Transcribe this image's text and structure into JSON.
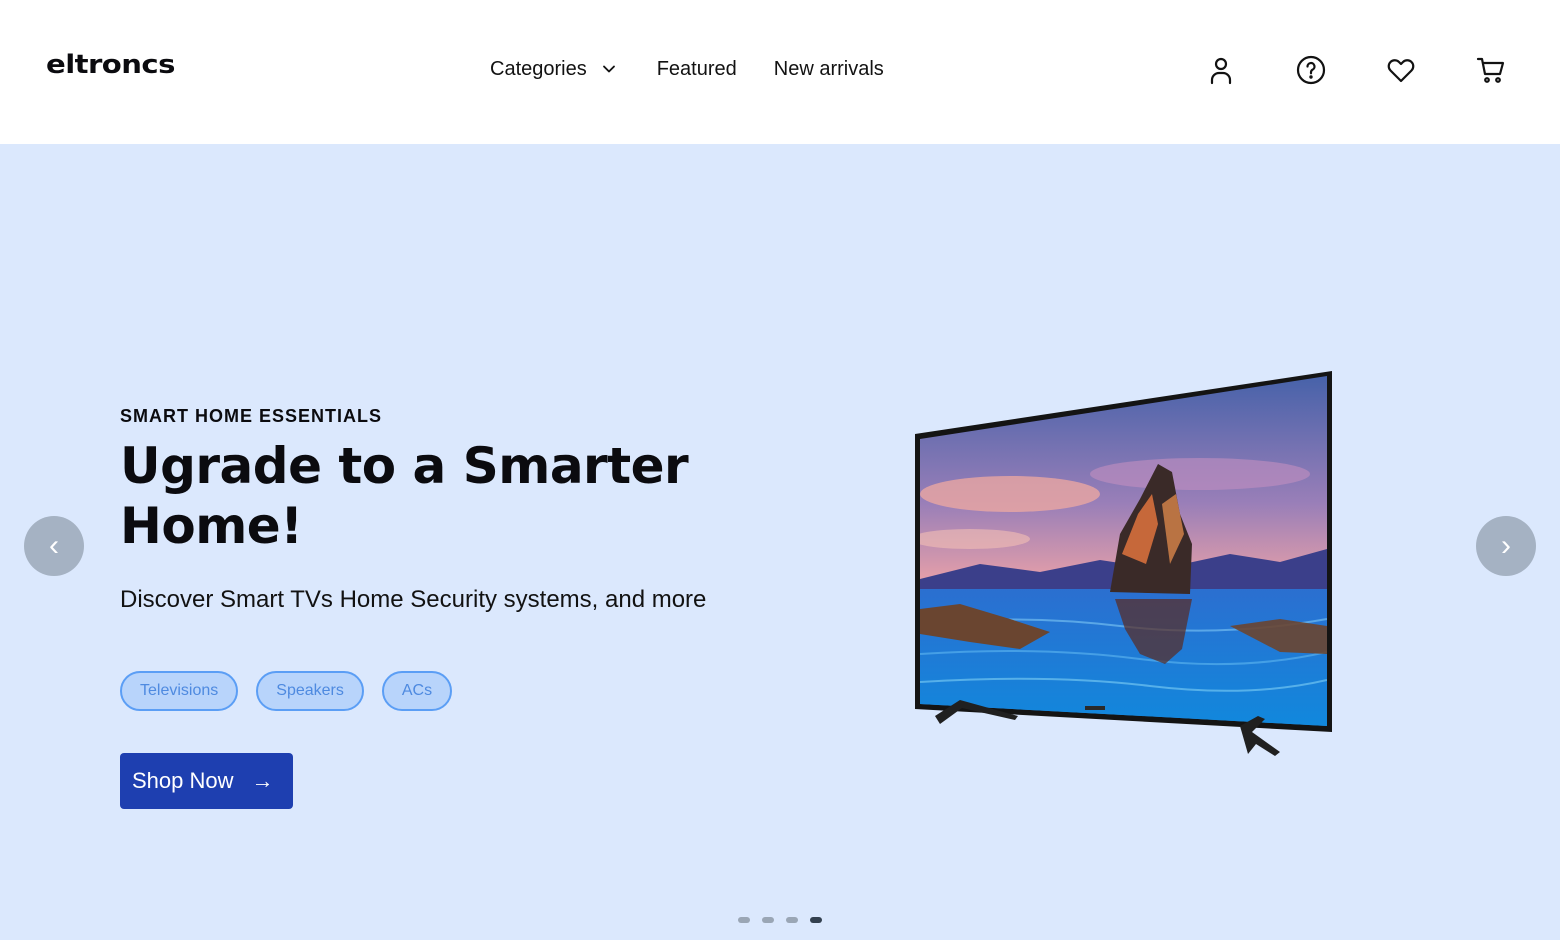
{
  "brand": {
    "logo_text": "eltroncs"
  },
  "nav": {
    "categories_label": "Categories",
    "featured_label": "Featured",
    "new_arrivals_label": "New arrivals"
  },
  "header_icons": [
    "user-icon",
    "help-icon",
    "heart-icon",
    "cart-icon"
  ],
  "hero": {
    "eyebrow": "SMART HOME ESSENTIALS",
    "headline": "Ugrade to a Smarter Home!",
    "subtext": "Discover Smart TVs Home Security systems, and more",
    "chips": [
      "Televisions",
      "Speakers",
      "ACs"
    ],
    "cta_label": "Shop Now",
    "cta_arrow": "→",
    "prev_arrow": "‹",
    "next_arrow": "›"
  },
  "carousel": {
    "slide_count": 4,
    "active_index": 3
  },
  "colors": {
    "hero_bg": "#dbe8fd",
    "cta_bg": "#1e3fb0",
    "chip_border": "#5b9ef5",
    "chip_bg": "#b8d4fb",
    "text": "#0b0b0f"
  }
}
